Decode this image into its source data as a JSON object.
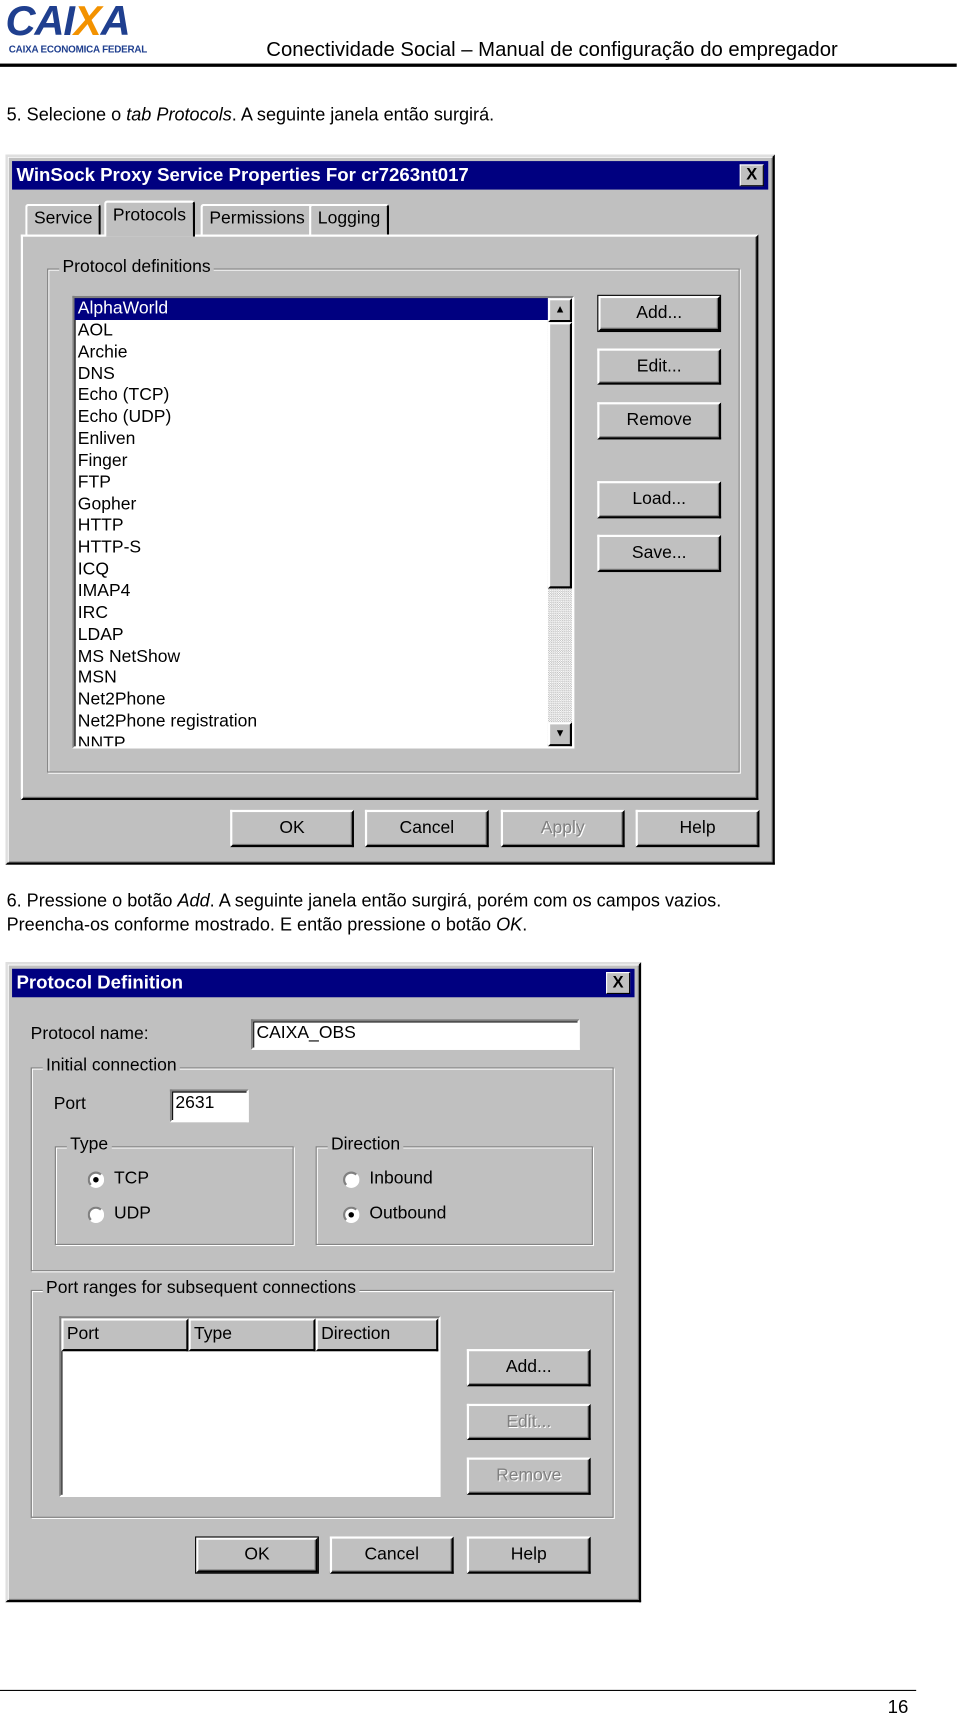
{
  "header": {
    "logo_text": "CAIXA",
    "logo_subtext": "CAIXA ECONOMICA FEDERAL",
    "title": "Conectividade Social – Manual de configuração do empregador"
  },
  "step5": {
    "prefix": "5. Selecione o ",
    "em": "tab Protocols",
    "suffix": ". A seguinte janela então surgirá."
  },
  "window1": {
    "title": "WinSock Proxy Service Properties For cr7263nt017",
    "close": "X",
    "tabs": [
      "Service",
      "Protocols",
      "Permissions",
      "Logging"
    ],
    "active_tab": "Protocols",
    "group_label": "Protocol definitions",
    "protocols": [
      "AlphaWorld",
      "AOL",
      "Archie",
      "DNS",
      "Echo (TCP)",
      "Echo (UDP)",
      "Enliven",
      "Finger",
      "FTP",
      "Gopher",
      "HTTP",
      "HTTP-S",
      "ICQ",
      "IMAP4",
      "IRC",
      "LDAP",
      "MS NetShow",
      "MSN",
      "Net2Phone",
      "Net2Phone registration",
      "NNTP"
    ],
    "selected": "AlphaWorld",
    "buttons": {
      "add": "Add...",
      "edit": "Edit...",
      "remove": "Remove",
      "load": "Load...",
      "save": "Save..."
    },
    "footer": {
      "ok": "OK",
      "cancel": "Cancel",
      "apply": "Apply",
      "help": "Help"
    }
  },
  "step6": {
    "prefix": "6. Pressione o botão ",
    "em": "Add",
    "suffix": ". A seguinte janela então surgirá, porém com os campos vazios.",
    "line2_prefix": "Preencha-os conforme mostrado. E então pressione o botão ",
    "line2_em": "OK",
    "line2_suffix": "."
  },
  "window2": {
    "title": "Protocol Definition",
    "close": "X",
    "protocol_name_label": "Protocol name:",
    "protocol_name": "CAIXA_OBS",
    "initial_connection_label": "Initial connection",
    "port_label": "Port",
    "port": "2631",
    "type_label": "Type",
    "type_options": [
      "TCP",
      "UDP"
    ],
    "type_selected": "TCP",
    "direction_label": "Direction",
    "direction_options": [
      "Inbound",
      "Outbound"
    ],
    "direction_selected": "Outbound",
    "port_ranges_label": "Port ranges for subsequent connections",
    "columns": [
      "Port",
      "Type",
      "Direction"
    ],
    "buttons": {
      "add": "Add...",
      "edit": "Edit...",
      "remove": "Remove"
    },
    "footer": {
      "ok": "OK",
      "cancel": "Cancel",
      "help": "Help"
    }
  },
  "page_number": "16"
}
